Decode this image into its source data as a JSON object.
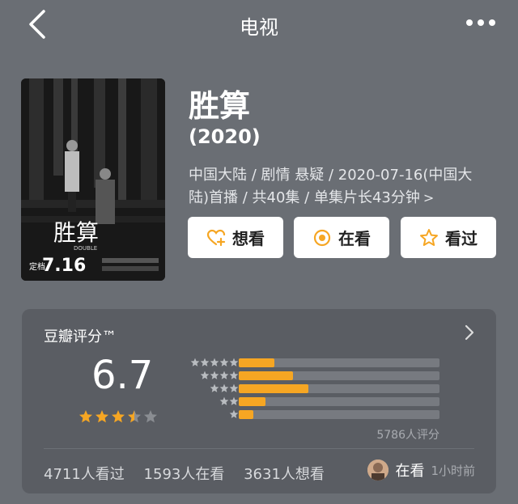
{
  "header": {
    "title": "电视",
    "back_icon": "back-chevron-icon",
    "more_icon": "more-dots-icon"
  },
  "movie": {
    "title": "胜算",
    "year": "(2020)",
    "meta": "中国大陆 / 剧情 悬疑 / 2020-07-16(中国大陆)首播 / 共40集 / 单集片长43分钟",
    "meta_chevron": ">",
    "poster": {
      "title_art": "胜算",
      "subtitle": "DOUBLE",
      "date_prefix": "定档",
      "date": "7.16"
    }
  },
  "actions": [
    {
      "label": "想看",
      "icon": "heart-plus-icon"
    },
    {
      "label": "在看",
      "icon": "target-circle-icon"
    },
    {
      "label": "看过",
      "icon": "star-outline-icon"
    }
  ],
  "rating": {
    "heading": "豆瓣评分™",
    "score": "6.7",
    "stars": 3.5,
    "distribution_percent": [
      17.6,
      27.2,
      34.8,
      13.2,
      7.2
    ],
    "raters": "5786人评分",
    "stats": {
      "watched": "4711人看过",
      "watching": "1593人在看",
      "wish": "3631人想看"
    },
    "friend": {
      "status": "在看",
      "time": "1小时前"
    }
  },
  "colors": {
    "background": "#6a6e74",
    "card": "#5a5d63",
    "accent": "#f6a623"
  }
}
